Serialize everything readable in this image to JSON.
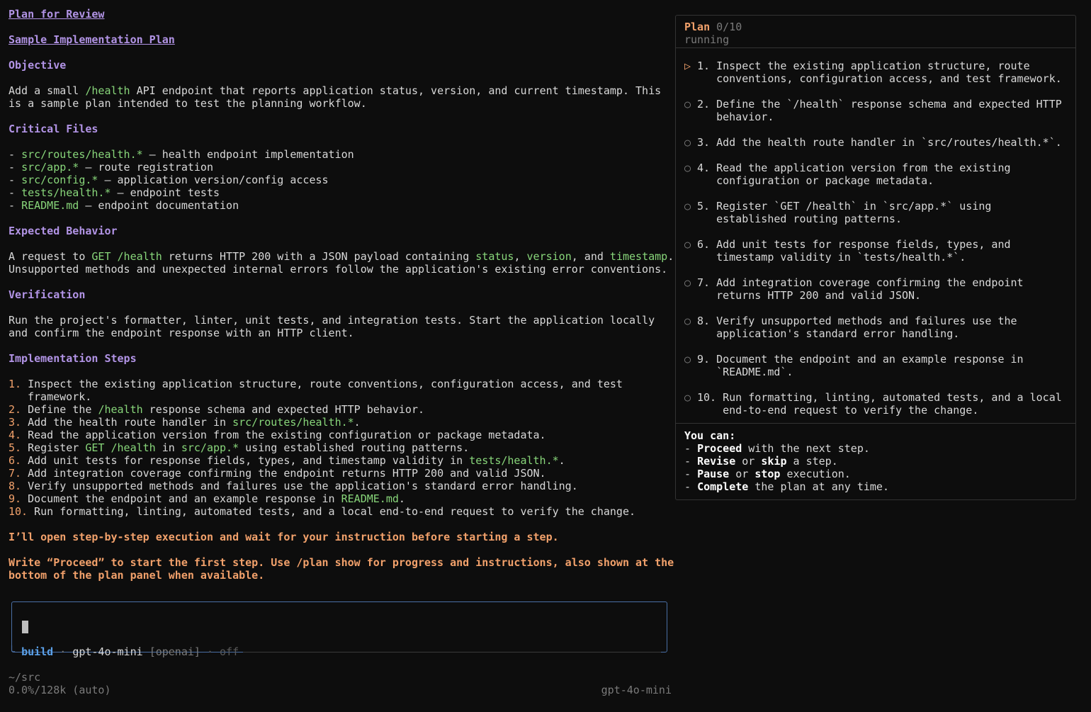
{
  "doc": {
    "title": "Plan for Review",
    "subtitle": "Sample Implementation Plan",
    "objective_heading": "Objective",
    "objective": [
      "Add a small ",
      "/health",
      " API endpoint that reports application status, version, and current timestamp. This",
      "is a sample plan intended to test the planning workflow."
    ],
    "critical_heading": "Critical Files",
    "files": [
      {
        "path": "src/routes/health.*",
        "desc": " — health endpoint implementation"
      },
      {
        "path": "src/app.*",
        "desc": " — route registration"
      },
      {
        "path": "src/config.*",
        "desc": " — application version/config access"
      },
      {
        "path": "tests/health.*",
        "desc": " — endpoint tests"
      },
      {
        "path": "README.md",
        "desc": " — endpoint documentation"
      }
    ],
    "expected_heading": "Expected Behavior",
    "expected": {
      "a": "A request to ",
      "b": "GET /health",
      "c": " returns HTTP 200 with a JSON payload containing ",
      "d": "status",
      "e": ", ",
      "f": "version",
      "g": ", and ",
      "h": "timestamp",
      "i": ".",
      "line2": "Unsupported methods and unexpected internal errors follow the application's existing error conventions."
    },
    "verification_heading": "Verification",
    "verification": [
      "Run the project's formatter, linter, unit tests, and integration tests. Start the application locally",
      "and confirm the endpoint response with an HTTP client."
    ],
    "steps_heading": "Implementation Steps",
    "steps": {
      "s1a": "Inspect the existing application structure, route conventions, configuration access, and test",
      "s1b": "framework.",
      "s2a": "Define the ",
      "s2b": "/health",
      "s2c": " response schema and expected HTTP behavior.",
      "s3a": "Add the health route handler in ",
      "s3b": "src/routes/health.*",
      "s3c": ".",
      "s4": "Read the application version from the existing configuration or package metadata.",
      "s5a": "Register ",
      "s5b": "GET /health",
      "s5c": " in ",
      "s5d": "src/app.*",
      "s5e": " using established routing patterns.",
      "s6a": "Add unit tests for response fields, types, and timestamp validity in ",
      "s6b": "tests/health.*",
      "s6c": ".",
      "s7": "Add integration coverage confirming the endpoint returns HTTP 200 and valid JSON.",
      "s8": "Verify unsupported methods and failures use the application's standard error handling.",
      "s9a": "Document the endpoint and an example response in ",
      "s9b": "README.md",
      "s9c": ".",
      "s10": "Run formatting, linting, automated tests, and a local end-to-end request to verify the change."
    },
    "nums": [
      "1.",
      "2.",
      "3.",
      "4.",
      "5.",
      "6.",
      "7.",
      "8.",
      "9.",
      "10."
    ],
    "note1": "I’ll open step-by-step execution and wait for your instruction before starting a step.",
    "note2a": "Write “Proceed” to start the first step. Use /plan show for progress and instructions, also shown at the",
    "note2b": "bottom of the plan panel when available."
  },
  "input": {
    "mode": "build",
    "sep": " · ",
    "model": "gpt-4o-mini",
    "provider": "[openai]",
    "reasoning": "off"
  },
  "footer": {
    "path": "~/src",
    "context": "0.0%/128k (auto)",
    "model": "gpt-4o-mini"
  },
  "panel": {
    "title": "Plan",
    "count": "0/10",
    "status": "running",
    "active_marker": "▷",
    "pending_marker": "○",
    "steps": [
      {
        "num": "1.",
        "text": "Inspect the existing application structure, route conventions, configuration access, and test framework."
      },
      {
        "num": "2.",
        "text": "Define the `/health` response schema and expected HTTP behavior."
      },
      {
        "num": "3.",
        "text": "Add the health route handler in `src/routes/health.*`."
      },
      {
        "num": "4.",
        "text": "Read the application version from the existing configuration or package metadata."
      },
      {
        "num": "5.",
        "text": "Register `GET /health` in `src/app.*` using established routing patterns."
      },
      {
        "num": "6.",
        "text": "Add unit tests for response fields, types, and timestamp validity in `tests/health.*`."
      },
      {
        "num": "7.",
        "text": "Add integration coverage confirming the endpoint returns HTTP 200 and valid JSON."
      },
      {
        "num": "8.",
        "text": "Verify unsupported methods and failures use the application's standard error handling."
      },
      {
        "num": "9.",
        "text": "Document the endpoint and an example response in `README.md`."
      },
      {
        "num": "10.",
        "text": "Run formatting, linting, automated tests, and a local end-to-end request to verify the change."
      }
    ],
    "you_can": "You can:",
    "actions": [
      {
        "pre": "- ",
        "b1": "Proceed",
        "t1": " with the next step.",
        "b2": "",
        "t2": ""
      },
      {
        "pre": "- ",
        "b1": "Revise",
        "t1": " or ",
        "b2": "skip",
        "t2": " a step."
      },
      {
        "pre": "- ",
        "b1": "Pause",
        "t1": " or ",
        "b2": "stop",
        "t2": " execution."
      },
      {
        "pre": "- ",
        "b1": "Complete",
        "t1": " the plan at any time.",
        "b2": "",
        "t2": ""
      }
    ]
  }
}
